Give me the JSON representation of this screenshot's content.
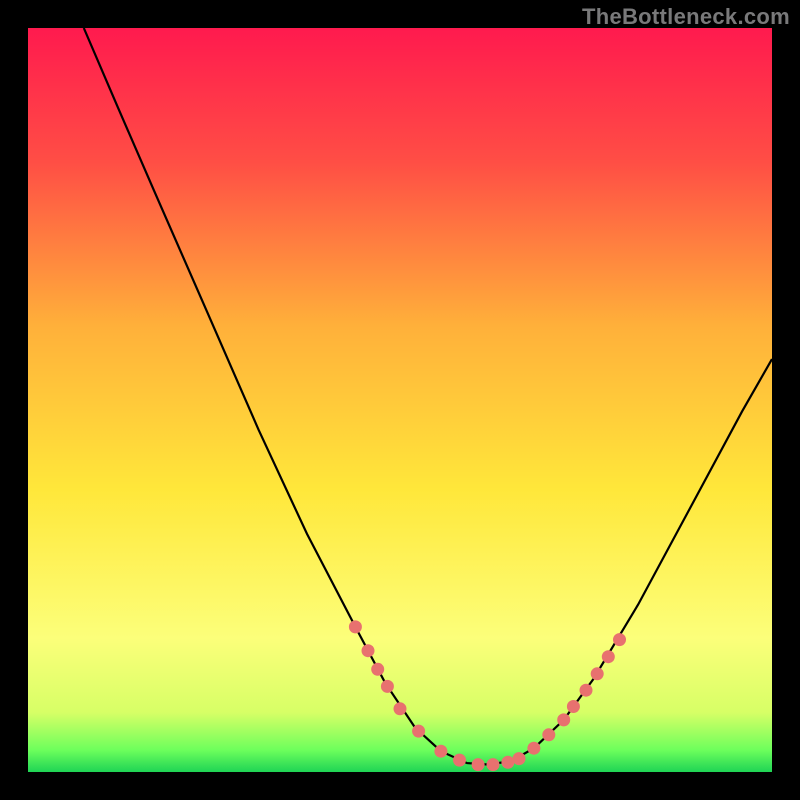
{
  "watermark": "TheBottleneck.com",
  "chart_data": {
    "type": "line",
    "title": "",
    "xlabel": "",
    "ylabel": "",
    "xlim": [
      0,
      100
    ],
    "ylim": [
      0,
      100
    ],
    "background_gradient": {
      "top": "#ff1a4e",
      "mid1": "#ffb43a",
      "mid2": "#ffe73a",
      "low": "#fcff7a",
      "bottom": "#28e05a"
    },
    "curve": [
      {
        "x": 7.5,
        "y": 100
      },
      {
        "x": 12.0,
        "y": 89.5
      },
      {
        "x": 17.0,
        "y": 78.0
      },
      {
        "x": 24.0,
        "y": 62.0
      },
      {
        "x": 31.0,
        "y": 46.0
      },
      {
        "x": 37.5,
        "y": 32.0
      },
      {
        "x": 44.0,
        "y": 19.5
      },
      {
        "x": 48.0,
        "y": 12.0
      },
      {
        "x": 52.0,
        "y": 6.0
      },
      {
        "x": 55.5,
        "y": 2.8
      },
      {
        "x": 59.0,
        "y": 1.2
      },
      {
        "x": 62.0,
        "y": 1.0
      },
      {
        "x": 65.0,
        "y": 1.5
      },
      {
        "x": 68.0,
        "y": 3.2
      },
      {
        "x": 72.0,
        "y": 7.0
      },
      {
        "x": 76.0,
        "y": 12.5
      },
      {
        "x": 82.0,
        "y": 22.5
      },
      {
        "x": 89.0,
        "y": 35.5
      },
      {
        "x": 96.0,
        "y": 48.5
      },
      {
        "x": 100.0,
        "y": 55.5
      }
    ],
    "markers": [
      {
        "x": 44.0,
        "y": 19.5
      },
      {
        "x": 45.7,
        "y": 16.3
      },
      {
        "x": 47.0,
        "y": 13.8
      },
      {
        "x": 48.3,
        "y": 11.5
      },
      {
        "x": 50.0,
        "y": 8.5
      },
      {
        "x": 52.5,
        "y": 5.5
      },
      {
        "x": 55.5,
        "y": 2.8
      },
      {
        "x": 58.0,
        "y": 1.6
      },
      {
        "x": 60.5,
        "y": 1.0
      },
      {
        "x": 62.5,
        "y": 1.0
      },
      {
        "x": 64.5,
        "y": 1.3
      },
      {
        "x": 66.0,
        "y": 1.8
      },
      {
        "x": 68.0,
        "y": 3.2
      },
      {
        "x": 70.0,
        "y": 5.0
      },
      {
        "x": 72.0,
        "y": 7.0
      },
      {
        "x": 73.3,
        "y": 8.8
      },
      {
        "x": 75.0,
        "y": 11.0
      },
      {
        "x": 76.5,
        "y": 13.2
      },
      {
        "x": 78.0,
        "y": 15.5
      },
      {
        "x": 79.5,
        "y": 17.8
      }
    ],
    "marker_color": "#e8716f",
    "curve_color": "#000000"
  }
}
